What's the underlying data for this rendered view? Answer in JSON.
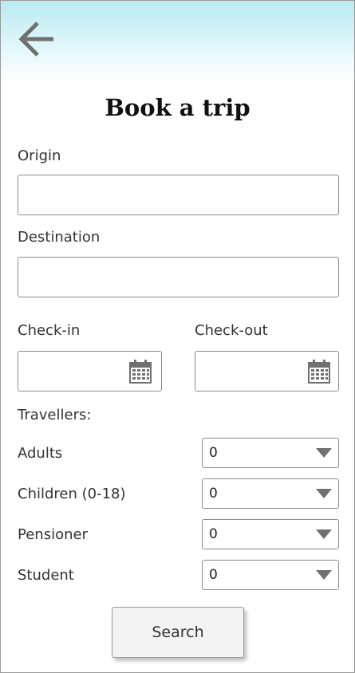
{
  "page": {
    "title": "Book a trip"
  },
  "nav": {
    "back_icon": "arrow-left-icon"
  },
  "colors": {
    "header_gradient_top": "#b9ebf2",
    "icon_gray": "#707070",
    "border": "#8c8c8c"
  },
  "form": {
    "origin": {
      "label": "Origin",
      "value": ""
    },
    "destination": {
      "label": "Destination",
      "value": ""
    },
    "checkin": {
      "label": "Check-in",
      "value": "",
      "icon": "calendar-icon"
    },
    "checkout": {
      "label": "Check-out",
      "value": "",
      "icon": "calendar-icon"
    },
    "travellers": {
      "heading": "Travellers:",
      "rows": [
        {
          "label": "Adults",
          "value": "0"
        },
        {
          "label": "Children (0-18)",
          "value": "0"
        },
        {
          "label": "Pensioner",
          "value": "0"
        },
        {
          "label": "Student",
          "value": "0"
        }
      ]
    }
  },
  "actions": {
    "search_label": "Search"
  }
}
